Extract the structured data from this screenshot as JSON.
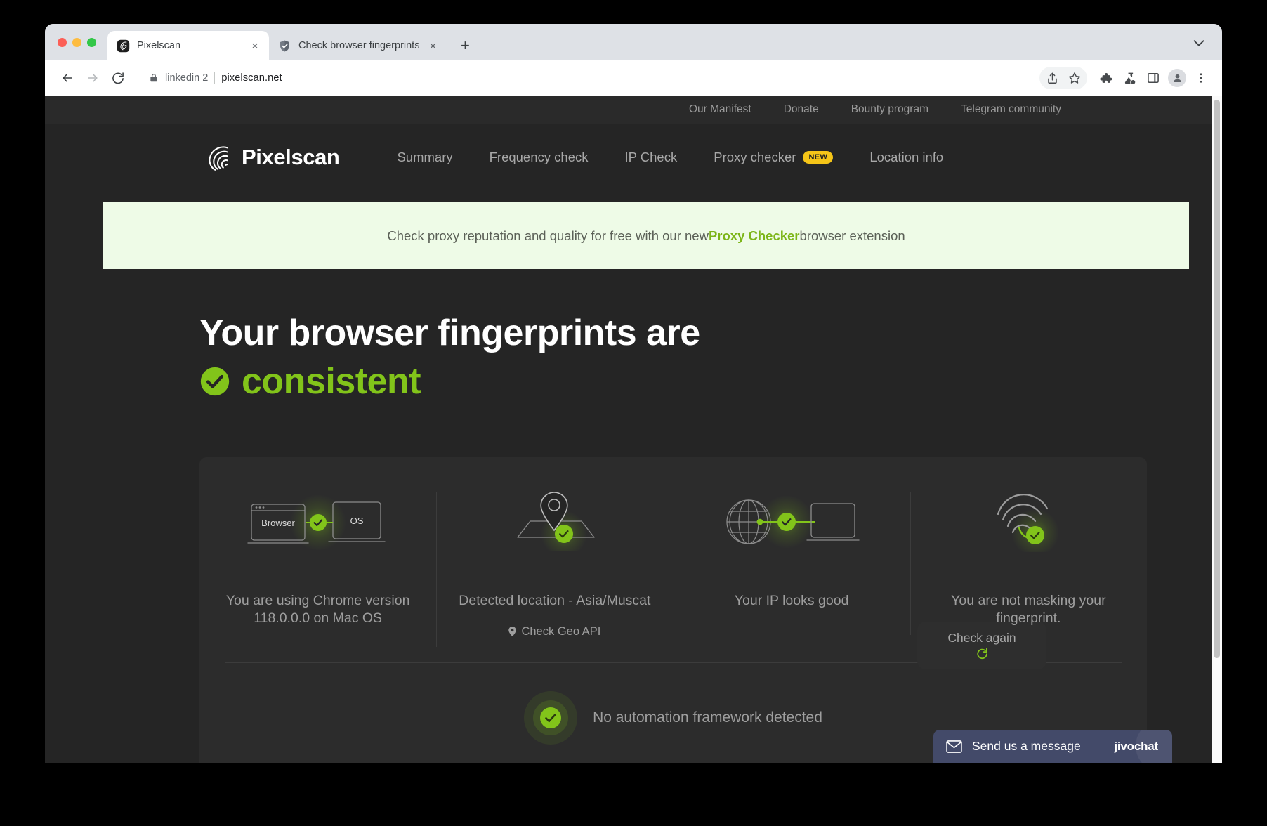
{
  "browser": {
    "tabs": [
      {
        "title": "Pixelscan",
        "favicon": "pixelscan-spiral-icon",
        "active": true,
        "close_label": "×"
      },
      {
        "title": "Check browser fingerprints",
        "favicon": "shield-check-icon",
        "active": false,
        "close_label": "×"
      }
    ],
    "new_tab_label": "+",
    "omnibox": {
      "profile_label": "linkedin 2",
      "url": "pixelscan.net",
      "lock_icon": "lock-icon"
    },
    "toolbar_icons": [
      "back-arrow-icon",
      "forward-arrow-icon",
      "reload-icon",
      "share-icon",
      "bookmark-star-icon",
      "extensions-puzzle-icon",
      "experiments-flask-icon",
      "side-panel-icon",
      "profile-avatar-icon",
      "chrome-menu-icon"
    ]
  },
  "utility_nav": {
    "items": [
      {
        "label": "Our Manifest"
      },
      {
        "label": "Donate"
      },
      {
        "label": "Bounty program"
      },
      {
        "label": "Telegram community"
      }
    ]
  },
  "header": {
    "brand_name": "Pixelscan",
    "brand_logo_icon": "pixelscan-spiral-logo",
    "nav": [
      {
        "label": "Summary",
        "badge": null
      },
      {
        "label": "Frequency check",
        "badge": null
      },
      {
        "label": "IP Check",
        "badge": null
      },
      {
        "label": "Proxy checker",
        "badge": "NEW"
      },
      {
        "label": "Location info",
        "badge": null
      }
    ]
  },
  "promo_banner": {
    "text_before": "Check proxy reputation and quality for free with our new ",
    "highlight": "Proxy Checker",
    "text_after": " browser extension"
  },
  "hero": {
    "line1": "Your browser fingerprints are",
    "status": "consistent",
    "status_icon": "check-circle-icon",
    "check_again": {
      "label": "Check again",
      "icon": "refresh-icon"
    }
  },
  "cards": [
    {
      "visual": "browser-os-match-icon",
      "left_label": "Browser",
      "right_label": "OS",
      "text": "You are using Chrome version 118.0.0.0 on Mac OS",
      "link": null
    },
    {
      "visual": "map-pin-location-icon",
      "text": "Detected location - Asia/Muscat",
      "link": {
        "label": "Check Geo API",
        "icon": "map-pin-small-icon"
      }
    },
    {
      "visual": "globe-laptop-ip-icon",
      "text": "Your IP looks good",
      "link": null
    },
    {
      "visual": "fingerprint-icon",
      "text": "You are not masking your fingerprint.",
      "link": null
    }
  ],
  "automation": {
    "icon": "check-circle-icon",
    "text": "No automation framework detected"
  },
  "jivochat": {
    "label": "Send us a message",
    "brand": "jivochat",
    "icon": "envelope-icon"
  },
  "colors": {
    "accent_green": "#82c41a",
    "badge_yellow": "#f5c518",
    "page_bg": "#252525",
    "panel_bg": "#2c2c2c",
    "banner_bg": "#eefbe7",
    "jivo_bg": "#434a69"
  }
}
